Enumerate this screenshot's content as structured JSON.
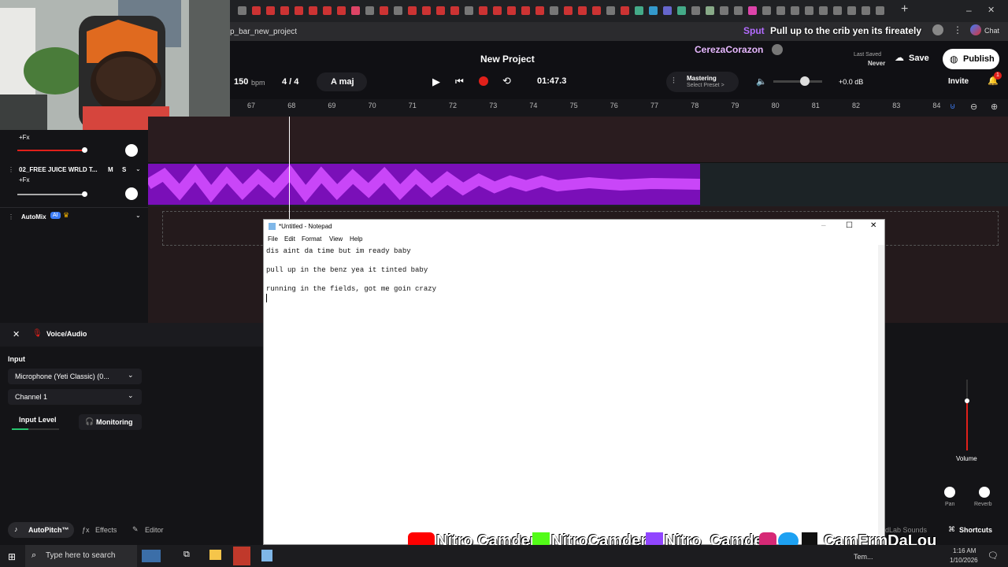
{
  "browser": {
    "url_fragment": "p_bar_new_project",
    "chat_user": "Sput",
    "chat_message": "Pull up to the crib yen its fireately",
    "chat_label": "Chat"
  },
  "daw": {
    "project_title": "New Project",
    "collaborator": "CerezaCorazon",
    "last_saved_label": "Last Saved",
    "last_saved_value": "Never",
    "save_label": "Save",
    "publish_label": "Publish",
    "invite_label": "Invite",
    "notification_count": "1",
    "bpm_value": "150",
    "bpm_unit": "bpm",
    "time_sig": "4 / 4",
    "key": "A maj",
    "time_display": "01:47.3",
    "mastering_label": "Mastering",
    "mastering_preset": "Select Preset >",
    "master_gain": "+0.0 dB",
    "ruler": [
      "67",
      "68",
      "69",
      "70",
      "71",
      "72",
      "73",
      "74",
      "75",
      "76",
      "77",
      "78",
      "79",
      "80",
      "81",
      "82",
      "83",
      "84"
    ]
  },
  "tracks": {
    "track1_fx": "+Fx",
    "track2_name": "02_FREE JUICE WRLD T...",
    "track2_m": "M",
    "track2_s": "S",
    "track2_fx": "+Fx",
    "automix_label": "AutoMix",
    "automix_badge": "AI"
  },
  "voice_panel": {
    "title": "Voice/Audio",
    "input_label": "Input",
    "device": "Microphone (Yeti Classic) (0...",
    "channel": "Channel 1",
    "input_level_label": "Input Level",
    "input_level": 0.35,
    "monitoring_label": "Monitoring"
  },
  "bottom_bar": {
    "autopitch": "AutoPitch™",
    "effects": "Effects",
    "editor": "Editor",
    "sounds": "dLab Sounds",
    "shortcuts": "Shortcuts"
  },
  "right_panel": {
    "volume_label": "Volume",
    "volume_level": 0.7,
    "pan_label": "Pan",
    "reverb_label": "Reverb"
  },
  "notepad": {
    "title": "*Untitled - Notepad",
    "menu": [
      "File",
      "Edit",
      "Format",
      "View",
      "Help"
    ],
    "lines": [
      "dis aint da time but im ready baby",
      "",
      "pull up in the benz yea it tinted baby",
      "",
      "running in the fields, got me goin crazy",
      ""
    ]
  },
  "overlay": {
    "youtube": "Nitro Camden",
    "kick": "NitroCamden",
    "twitch": "Nitro_Camden",
    "social": "CamFrmDaLou"
  },
  "taskbar": {
    "search_placeholder": "Type here to search",
    "time": "1:16 AM",
    "date": "1/10/2026",
    "temp_label": "Tem..."
  },
  "colors": {
    "accent_purple": "#8a00e6",
    "waveform": "#b31aff",
    "record_red": "#e0201a",
    "automix_blue": "#3d7df6"
  }
}
